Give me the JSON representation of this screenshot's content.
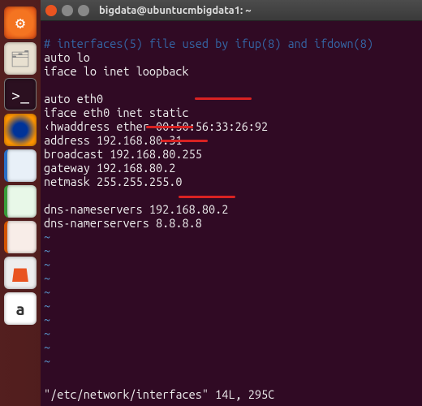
{
  "window": {
    "title": "bigdata@ubuntucmbigdata1: ~"
  },
  "launcher": {
    "items": [
      {
        "name": "ubuntu-dash-icon",
        "glyph": "⚙"
      },
      {
        "name": "files-icon",
        "glyph": "🗂"
      },
      {
        "name": "terminal-icon",
        "glyph": ">_"
      },
      {
        "name": "firefox-icon",
        "glyph": ""
      },
      {
        "name": "writer-icon",
        "glyph": ""
      },
      {
        "name": "calc-icon",
        "glyph": ""
      },
      {
        "name": "impress-icon",
        "glyph": ""
      },
      {
        "name": "software-center-icon",
        "glyph": ""
      },
      {
        "name": "amazon-icon",
        "glyph": "a"
      }
    ]
  },
  "editor": {
    "comment": "# interfaces(5) file used by ifup(8) and ifdown(8)",
    "lines": {
      "l1": "auto lo",
      "l2": "iface lo inet loopback",
      "l3": "",
      "l4": "auto eth0",
      "l5": "iface eth0 inet static",
      "l6": "hwaddress ether 00:50:56:33:26:92",
      "l7": "address 192.168.80.31",
      "l8": "broadcast 192.168.80.255",
      "l9": "gateway 192.168.80.2",
      "l10": "netmask 255.255.255.0",
      "l11": "",
      "l12": "dns-nameservers 192.168.80.2",
      "l13": "dns-namerservers 8.8.8.8"
    },
    "tildes": [
      "~",
      "~",
      "~",
      "~",
      "~",
      "~",
      "~",
      "~",
      "~",
      "~"
    ],
    "status": "\"/etc/network/interfaces\" 14L, 295C",
    "cursor_glyph": "‹"
  }
}
